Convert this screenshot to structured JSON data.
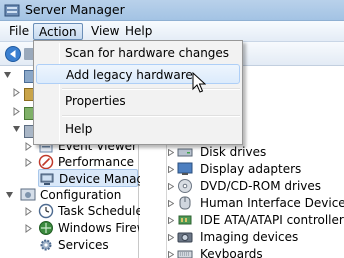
{
  "window": {
    "title": "Server Manager"
  },
  "menubar": {
    "items": [
      "File",
      "Action",
      "View",
      "Help"
    ]
  },
  "action_menu": {
    "items": [
      {
        "label": "Scan for hardware changes",
        "hovered": false
      },
      {
        "label": "Add legacy hardware",
        "hovered": true
      },
      {
        "label": "Properties",
        "hovered": false
      },
      {
        "label": "Help",
        "hovered": false
      }
    ]
  },
  "tree": {
    "items": [
      {
        "label": "Event Viewer"
      },
      {
        "label": "Performance"
      },
      {
        "label": "Device Manager",
        "selected": true
      },
      {
        "label": "Configuration"
      },
      {
        "label": "Task Scheduler"
      },
      {
        "label": "Windows Firewa"
      },
      {
        "label": "Services"
      }
    ]
  },
  "devices": {
    "items": [
      {
        "label": "Disk drives"
      },
      {
        "label": "Display adapters"
      },
      {
        "label": "DVD/CD-ROM drives"
      },
      {
        "label": "Human Interface Devices"
      },
      {
        "label": "IDE ATA/ATAPI controllers"
      },
      {
        "label": "Imaging devices"
      },
      {
        "label": "Keyboards"
      }
    ]
  },
  "colors": {
    "titlebar": "#b9d1ea",
    "menu_hover": "#dcebfc",
    "selection": "#d9e8f9"
  }
}
